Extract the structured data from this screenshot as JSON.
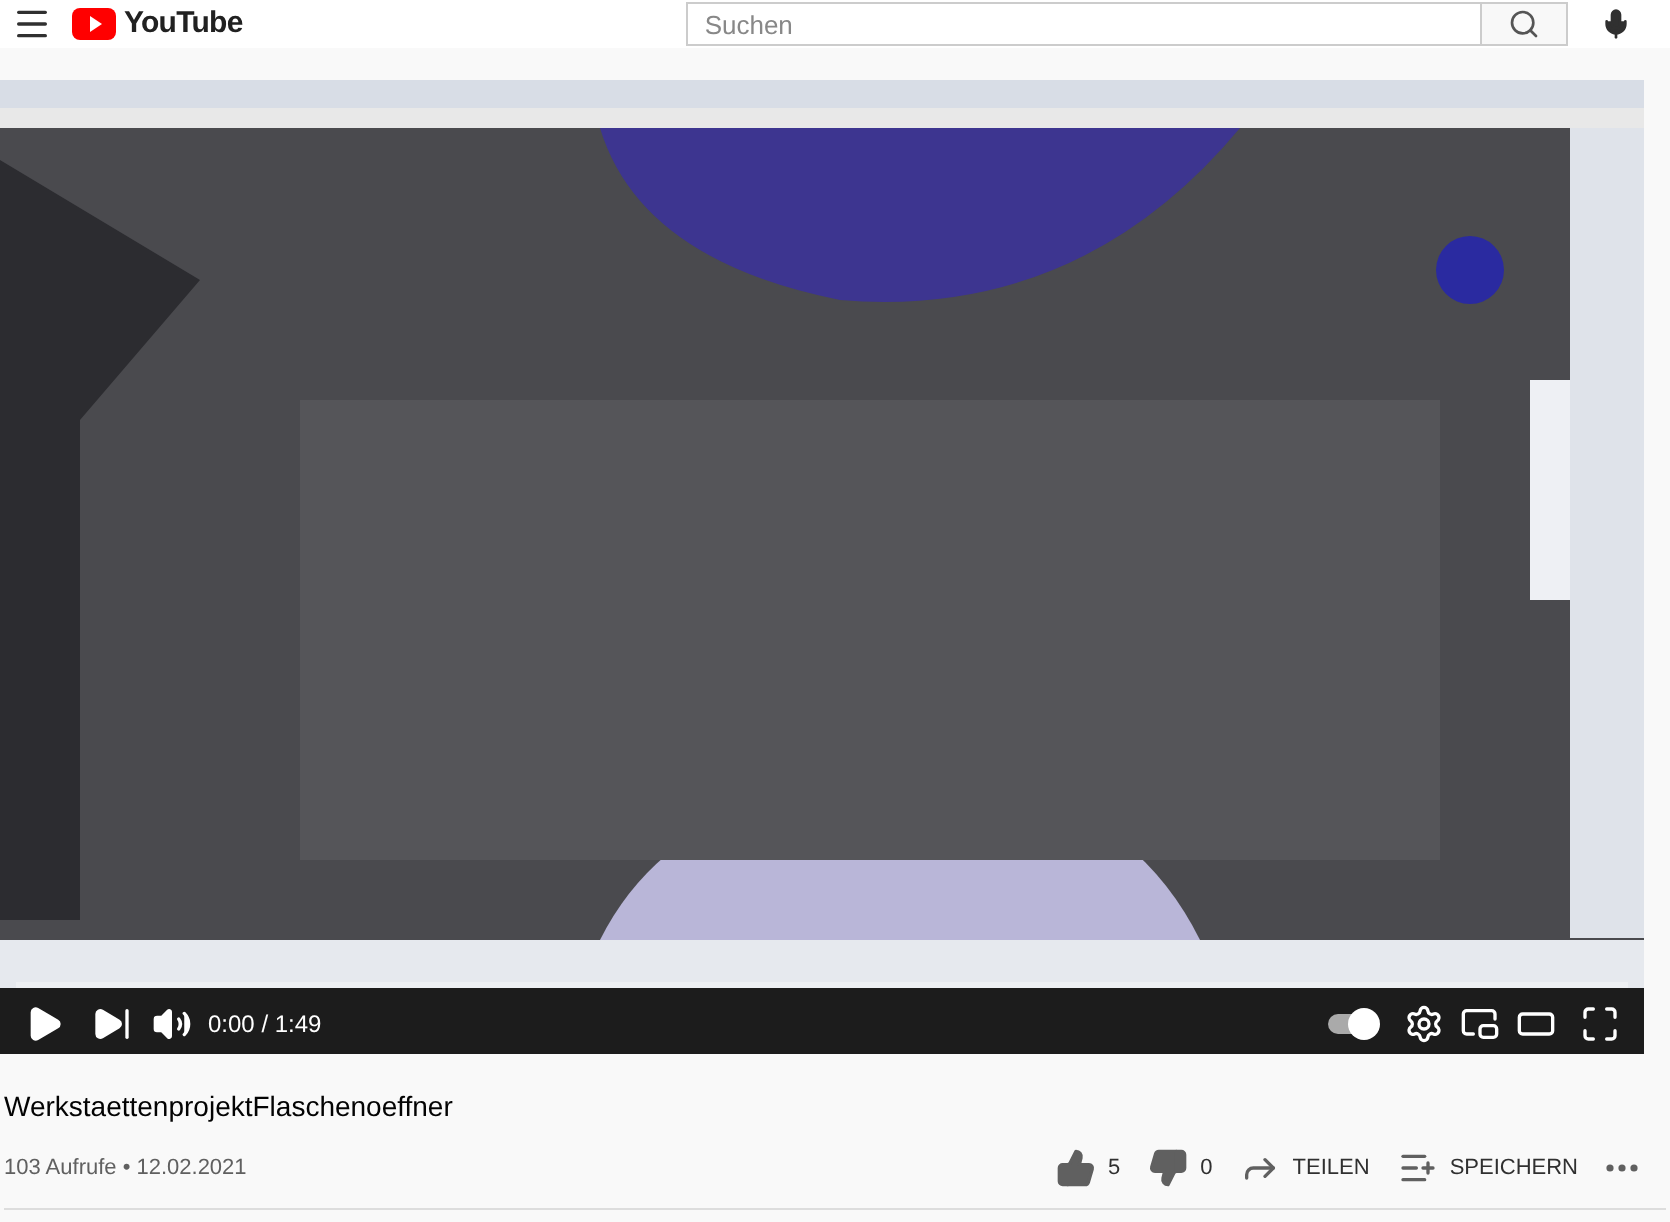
{
  "header": {
    "logo": "YouTube",
    "search": {
      "placeholder": "Suchen"
    }
  },
  "player": {
    "time": "0:00 / 1:49",
    "autoplay": {
      "on": true
    }
  },
  "video_title": "WerkstaettenprojektFlaschenoeffner",
  "meta": "103 Aufrufe • 12.02.2021",
  "actions": [
    {
      "kind": "like",
      "label": "5"
    },
    {
      "kind": "dislike",
      "label": "0"
    },
    {
      "kind": "share",
      "label": "TEILEN"
    },
    {
      "kind": "save",
      "label": "SPEICHERN"
    },
    {
      "kind": "more"
    }
  ]
}
